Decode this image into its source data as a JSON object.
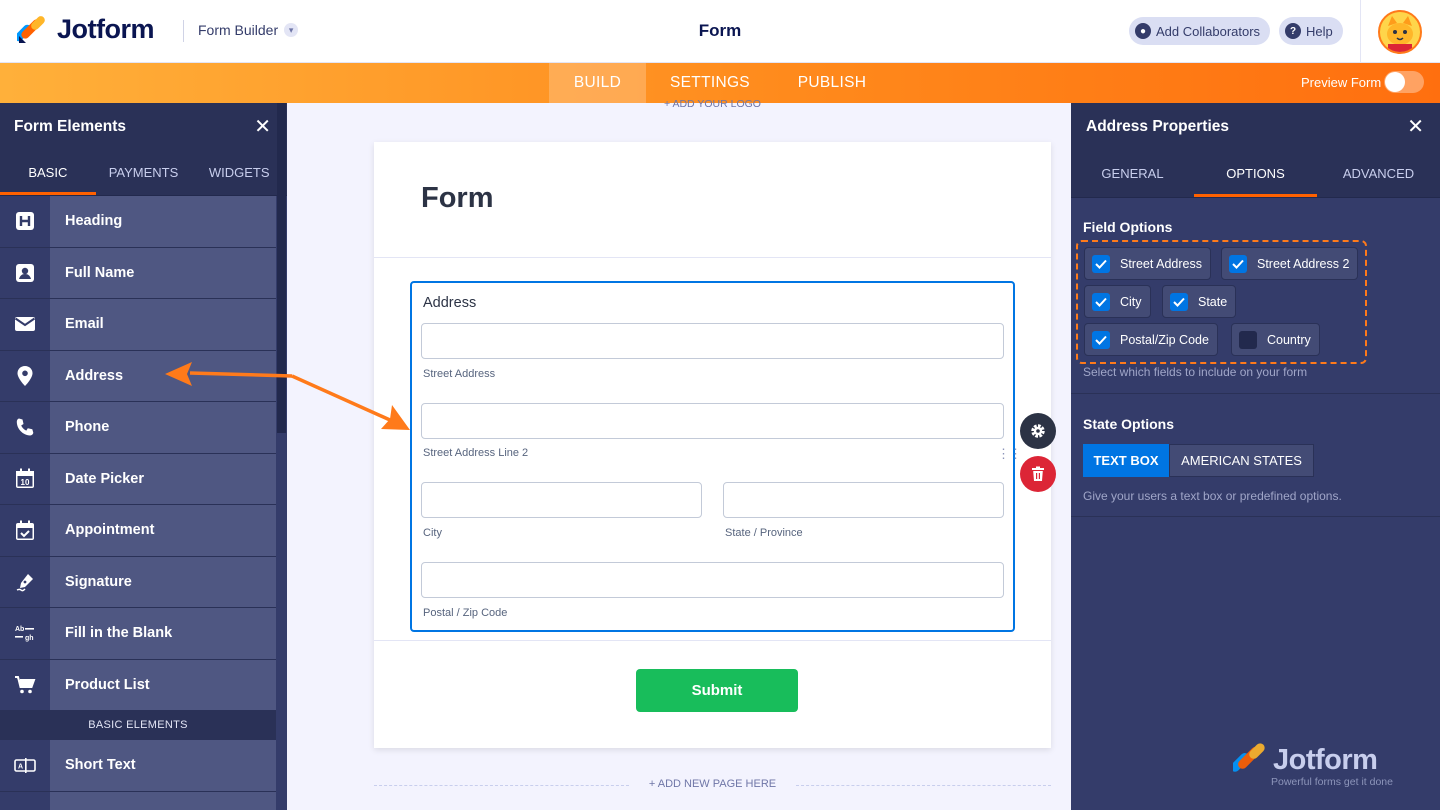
{
  "header": {
    "brand": "Jotform",
    "builder_label": "Form Builder",
    "form_title": "Form",
    "add_collaborators": "Add Collaborators",
    "help": "Help"
  },
  "nav": {
    "tabs": [
      "BUILD",
      "SETTINGS",
      "PUBLISH"
    ],
    "active": "BUILD",
    "preview_label": "Preview Form",
    "preview_on": false
  },
  "left_panel": {
    "title": "Form Elements",
    "tabs": [
      "BASIC",
      "PAYMENTS",
      "WIDGETS"
    ],
    "items": [
      {
        "label": "Heading",
        "icon": "heading-icon"
      },
      {
        "label": "Full Name",
        "icon": "user-icon"
      },
      {
        "label": "Email",
        "icon": "envelope-icon"
      },
      {
        "label": "Address",
        "icon": "map-pin-icon"
      },
      {
        "label": "Phone",
        "icon": "phone-icon"
      },
      {
        "label": "Date Picker",
        "icon": "calendar-icon"
      },
      {
        "label": "Appointment",
        "icon": "calendar-check-icon"
      },
      {
        "label": "Signature",
        "icon": "pen-icon"
      },
      {
        "label": "Fill in the Blank",
        "icon": "fill-blank-icon"
      },
      {
        "label": "Product List",
        "icon": "cart-icon"
      }
    ],
    "section_label": "BASIC ELEMENTS",
    "section_items": [
      {
        "label": "Short Text",
        "icon": "short-text-icon"
      }
    ]
  },
  "canvas": {
    "add_logo": "+ ADD YOUR LOGO",
    "form_heading": "Form",
    "address_label": "Address",
    "fields": {
      "street": "Street Address",
      "street2": "Street Address Line 2",
      "city": "City",
      "state": "State / Province",
      "postal": "Postal / Zip Code"
    },
    "submit": "Submit",
    "add_page": "+ ADD NEW PAGE HERE"
  },
  "right_panel": {
    "title": "Address Properties",
    "tabs": [
      "GENERAL",
      "OPTIONS",
      "ADVANCED"
    ],
    "active_tab": "OPTIONS",
    "field_options_title": "Field Options",
    "field_options": [
      {
        "label": "Street Address",
        "checked": true
      },
      {
        "label": "Street Address 2",
        "checked": true
      },
      {
        "label": "City",
        "checked": true
      },
      {
        "label": "State",
        "checked": true
      },
      {
        "label": "Postal/Zip Code",
        "checked": true
      },
      {
        "label": "Country",
        "checked": false
      }
    ],
    "field_options_help": "Select which fields to include on your form",
    "state_options_title": "State Options",
    "state_options": [
      "TEXT BOX",
      "AMERICAN STATES"
    ],
    "state_selected": "TEXT BOX",
    "state_options_help": "Give your users a text box or predefined options."
  },
  "watermark": {
    "brand": "Jotform",
    "tagline": "Powerful forms get it done"
  },
  "colors": {
    "accent_orange": "#ff6100",
    "panel_dark": "#343c6a",
    "selected_blue": "#0075e3",
    "submit_green": "#18bd5b",
    "delete_red": "#dc2536"
  }
}
